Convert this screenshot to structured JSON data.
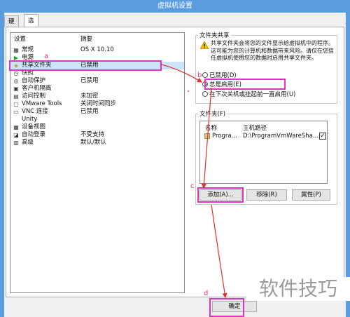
{
  "window": {
    "title": "虚拟机设置"
  },
  "tabs": [
    "硬件",
    "选项"
  ],
  "settings_list": {
    "header": {
      "name": "设置",
      "summary": "摘要"
    },
    "rows": [
      {
        "icon": "general-icon",
        "name": "常规",
        "summary": "OS X 10.10"
      },
      {
        "icon": "power-icon",
        "name": "电源",
        "summary": ""
      },
      {
        "icon": "shared-folder-icon",
        "name": "共享文件夹",
        "summary": "已禁用"
      },
      {
        "icon": "snapshot-icon",
        "name": "快照",
        "summary": ""
      },
      {
        "icon": "autoprotect-icon",
        "name": "自动保护",
        "summary": "已禁用"
      },
      {
        "icon": "guest-isolation-icon",
        "name": "客户机隔离",
        "summary": ""
      },
      {
        "icon": "access-control-icon",
        "name": "访问控制",
        "summary": "未加密"
      },
      {
        "icon": "vmware-tools-icon",
        "name": "VMware Tools",
        "summary": "关闭时间同步"
      },
      {
        "icon": "vnc-icon",
        "name": "VNC 连接",
        "summary": "已禁用"
      },
      {
        "icon": "unity-icon",
        "name": "Unity",
        "summary": ""
      },
      {
        "icon": "device-view-icon",
        "name": "设备视图",
        "summary": ""
      },
      {
        "icon": "autologin-icon",
        "name": "自动登录",
        "summary": "不受支持"
      },
      {
        "icon": "advanced-icon",
        "name": "高级",
        "summary": "默认/默认"
      }
    ]
  },
  "folder_sharing": {
    "title": "文件夹共享",
    "warning": "共享文件夹会将您的文件显示给虚拟机中的程序。这可能为您的计算机和数据带来风险。请仅在您信任虚拟机使用您的数据时启用共享文件夹。",
    "options": [
      {
        "label": "已禁用(D)",
        "selected": false
      },
      {
        "label": "总是启用(E)",
        "selected": true
      },
      {
        "label": "在下次关机或挂起前一直启用(U)",
        "selected": false
      }
    ]
  },
  "folders": {
    "title": "文件夹(F)",
    "columns": {
      "name": "名称",
      "host_path": "主机路径"
    },
    "rows": [
      {
        "name": "Progra...",
        "host_path": "D:\\ProgramVmWareSha...",
        "checked": true
      }
    ],
    "buttons": {
      "add": "添加(A)...",
      "remove": "移除(R)",
      "properties": "属性(P)"
    }
  },
  "footer": {
    "ok": "确定"
  },
  "annotations": {
    "a": "a",
    "b": "b",
    "c": "c",
    "d": "d"
  },
  "watermark": "软件技巧",
  "colors": {
    "titlebar": "#5a9cde",
    "highlight": "#e033c6",
    "arrow": "#e03030"
  }
}
